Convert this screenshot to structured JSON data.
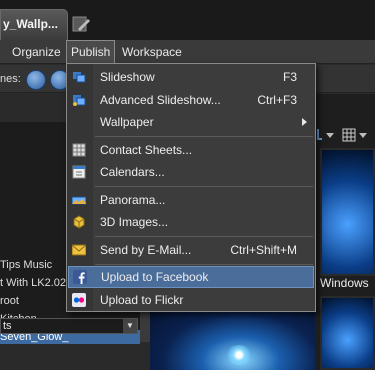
{
  "tab": {
    "title": "y_Wallp..."
  },
  "menubar": {
    "organize": "Organize",
    "publish": "Publish",
    "workspace": "Workspace"
  },
  "toolbar": {
    "label": "nes:"
  },
  "tree": {
    "items": [
      "Tips Music",
      "t With LK2.02",
      "root",
      "Kitchen",
      "Seven_Glow_",
      "ts"
    ],
    "selected_index": 4
  },
  "thumbnail": {
    "caption": "Windows"
  },
  "publish_menu": {
    "items": [
      {
        "label": "Slideshow",
        "shortcut": "F3",
        "icon": "slideshow-icon"
      },
      {
        "label": "Advanced Slideshow...",
        "shortcut": "Ctrl+F3",
        "icon": "advanced-slideshow-icon"
      },
      {
        "label": "Wallpaper",
        "shortcut": "",
        "icon": "",
        "submenu": true
      },
      {
        "label": "Contact Sheets...",
        "shortcut": "",
        "icon": "contact-sheets-icon"
      },
      {
        "label": "Calendars...",
        "shortcut": "",
        "icon": "calendar-icon"
      },
      {
        "label": "Panorama...",
        "shortcut": "",
        "icon": "panorama-icon"
      },
      {
        "label": "3D Images...",
        "shortcut": "",
        "icon": "3d-images-icon"
      },
      {
        "label": "Send by E-Mail...",
        "shortcut": "Ctrl+Shift+M",
        "icon": "email-icon"
      },
      {
        "label": "Upload to Facebook",
        "shortcut": "",
        "icon": "facebook-icon",
        "highlighted": true
      },
      {
        "label": "Upload to Flickr",
        "shortcut": "",
        "icon": "flickr-icon"
      }
    ]
  },
  "colors": {
    "highlight": "#4a6d99",
    "facebook": "#3b5998",
    "flickr_pink": "#ff0084",
    "flickr_blue": "#0063dc"
  }
}
